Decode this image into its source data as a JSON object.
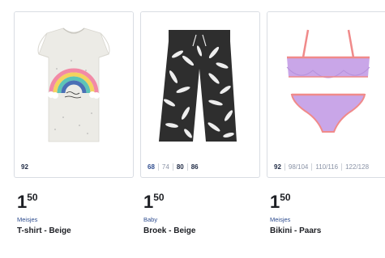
{
  "products": [
    {
      "image_alt": "T-shirt met regenboog",
      "sizes": [
        {
          "label": "92",
          "available": true
        }
      ],
      "price_int": "1",
      "price_dec": "50",
      "category": "Meisjes",
      "title": "T-shirt - Beige"
    },
    {
      "image_alt": "Broek met bladprint",
      "sizes": [
        {
          "label": "68",
          "available": true
        },
        {
          "label": "74",
          "available": false
        },
        {
          "label": "80",
          "available": true
        },
        {
          "label": "86",
          "available": true
        }
      ],
      "price_int": "1",
      "price_dec": "50",
      "category": "Baby",
      "title": "Broek - Beige"
    },
    {
      "image_alt": "Bikini paars",
      "sizes": [
        {
          "label": "92",
          "available": true
        },
        {
          "label": "98/104",
          "available": false
        },
        {
          "label": "110/116",
          "available": false
        },
        {
          "label": "122/128",
          "available": false
        }
      ],
      "price_int": "1",
      "price_dec": "50",
      "category": "Meisjes",
      "title": "Bikini - Paars"
    }
  ]
}
